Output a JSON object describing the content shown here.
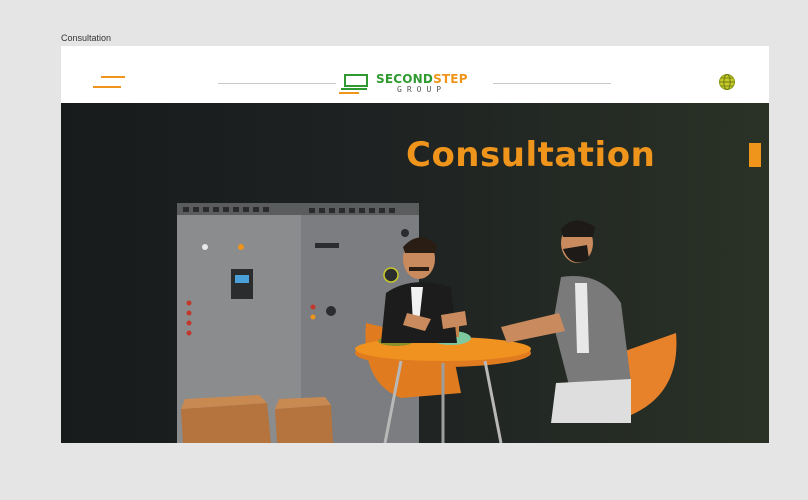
{
  "page": {
    "frame_label": "Consultation"
  },
  "header": {
    "logo": {
      "name_part1": "SECOND",
      "name_part2": "STEP",
      "subtitle": "GROUP"
    }
  },
  "hero": {
    "title": "Consultation"
  },
  "colors": {
    "accent": "#f0951c",
    "brand_green": "#2f9a2f",
    "hero_bg": "#1c2020"
  },
  "icons": [
    "menu-icon",
    "globe-icon",
    "logo-mark-icon"
  ]
}
